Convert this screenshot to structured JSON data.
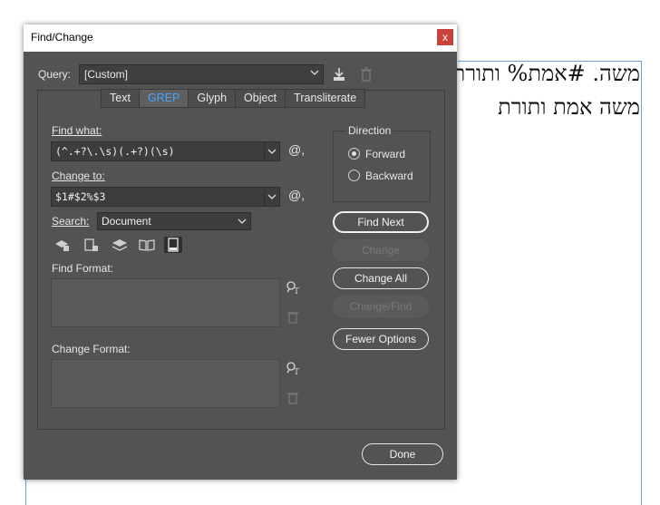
{
  "document": {
    "line1": "משה. #אמת% ותורת",
    "line2": "משה אמת ותורת"
  },
  "dialog": {
    "title": "Find/Change",
    "close_label": "x",
    "query_label": "Query:",
    "query_value": "[Custom]",
    "tabs": [
      "Text",
      "GREP",
      "Glyph",
      "Object",
      "Transliterate"
    ],
    "active_tab": "GREP",
    "find_what_label": "Find what:",
    "find_what_value": "(^.+?\\.\\s)(.+?)(\\s)",
    "change_to_label": "Change to:",
    "change_to_value": "$1#$2%$3",
    "search_label": "Search:",
    "search_value": "Document",
    "find_format_label": "Find Format:",
    "change_format_label": "Change Format:",
    "direction": {
      "label": "Direction",
      "options": [
        "Forward",
        "Backward"
      ],
      "selected": "Forward"
    },
    "buttons": {
      "find_next": "Find Next",
      "change": "Change",
      "change_all": "Change All",
      "change_find": "Change/Find",
      "fewer_options": "Fewer Options",
      "done": "Done"
    },
    "colors": {
      "background": "#535353",
      "active_tab_text": "#4aa3ff",
      "close_button": "#c9433c"
    }
  }
}
